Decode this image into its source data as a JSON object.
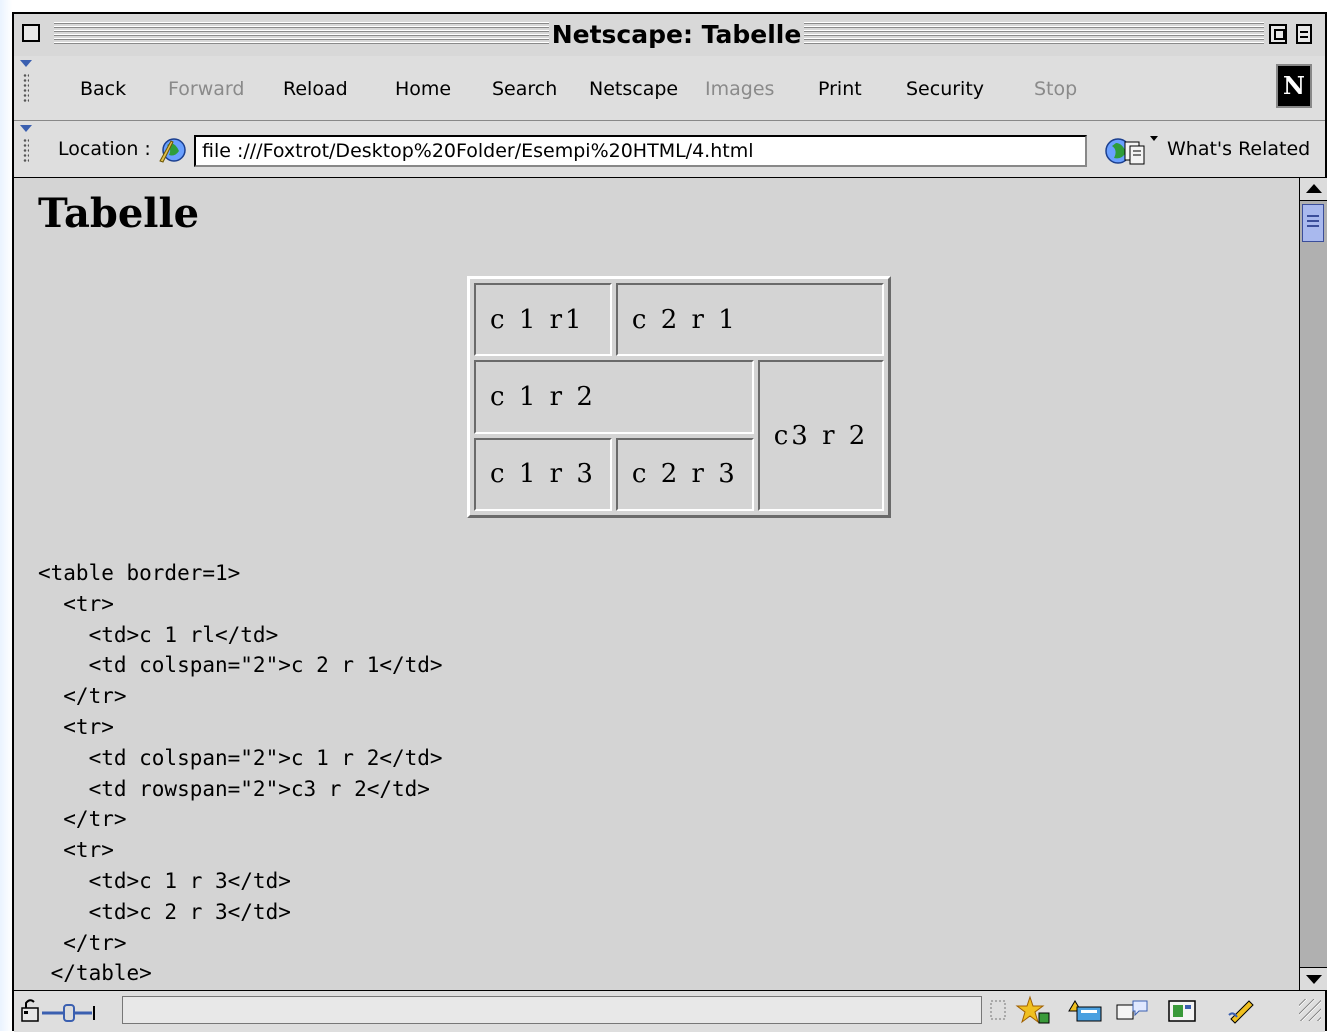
{
  "window": {
    "title": "Netscape: Tabelle"
  },
  "toolbar": {
    "buttons": [
      {
        "label": "Back",
        "enabled": true
      },
      {
        "label": "Forward",
        "enabled": false
      },
      {
        "label": "Reload",
        "enabled": true
      },
      {
        "label": "Home",
        "enabled": true
      },
      {
        "label": "Search",
        "enabled": true
      },
      {
        "label": "Netscape",
        "enabled": true
      },
      {
        "label": "Images",
        "enabled": false
      },
      {
        "label": "Print",
        "enabled": true
      },
      {
        "label": "Security",
        "enabled": true
      },
      {
        "label": "Stop",
        "enabled": false
      }
    ],
    "logo_letter": "N"
  },
  "location": {
    "label": "Location :",
    "url": "file :///Foxtrot/Desktop%20Folder/Esempi%20HTML/4.html",
    "related": "What's Related"
  },
  "page": {
    "heading": "Tabelle",
    "table": {
      "r1": {
        "c1": "c 1 r1",
        "c2": "c 2 r 1"
      },
      "r2": {
        "c1": "c 1 r 2",
        "c3": "c3 r 2"
      },
      "r3": {
        "c1": "c 1 r 3",
        "c2": "c 2 r 3"
      }
    },
    "code_lines": [
      "<table border=1>",
      "  <tr>",
      "    <td>c 1 rl</td>",
      "    <td colspan=\"2\">c 2 r 1</td>",
      "  </tr>",
      "  <tr>",
      "    <td colspan=\"2\">c 1 r 2</td>",
      "    <td rowspan=\"2\">c3 r 2</td>",
      "  </tr>",
      "  <tr>",
      "    <td>c 1 r 3</td>",
      "    <td>c 2 r 3</td>",
      "  </tr>",
      " </table>"
    ]
  },
  "colors": {
    "content_bg": "#d4d4d4",
    "scroll_thumb": "#a9b9ee",
    "location_icon": "#3a5fb0"
  },
  "icons": [
    "location-globe-icon",
    "whats-related-icon",
    "lock-icon",
    "plug-icon",
    "component-bar-icons",
    "grow-box-icon"
  ]
}
